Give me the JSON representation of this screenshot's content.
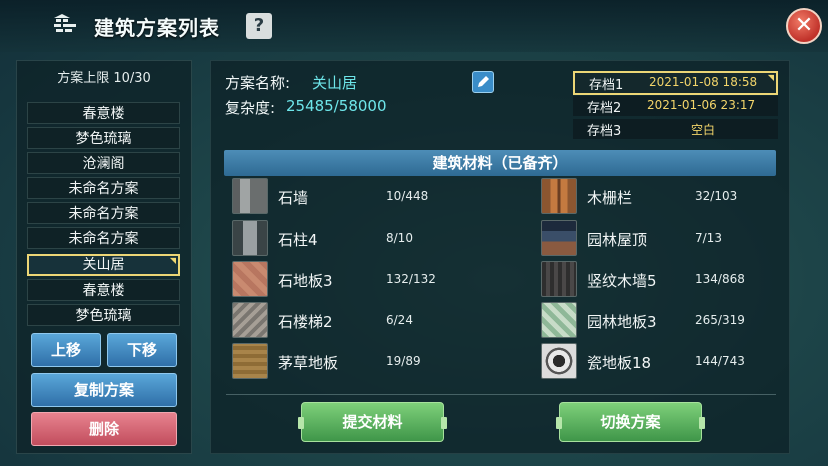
{
  "header": {
    "title": "建筑方案列表",
    "help": "?",
    "close": "✕"
  },
  "left": {
    "quota": "方案上限 10/30",
    "plans": [
      {
        "label": "春意楼"
      },
      {
        "label": "梦色琉璃"
      },
      {
        "label": "沧澜阁"
      },
      {
        "label": "未命名方案"
      },
      {
        "label": "未命名方案"
      },
      {
        "label": "未命名方案"
      },
      {
        "label": "关山居",
        "selected": true
      },
      {
        "label": "春意楼"
      },
      {
        "label": "梦色琉璃"
      }
    ],
    "move_up": "上移",
    "move_down": "下移",
    "copy": "复制方案",
    "delete": "删除"
  },
  "detail": {
    "name_label": "方案名称:",
    "name_value": "关山居",
    "complexity_label": "复杂度:",
    "complexity_value": "25485/58000",
    "saves": [
      {
        "name": "存档1",
        "date": "2021-01-08 18:58",
        "selected": true
      },
      {
        "name": "存档2",
        "date": "2021-01-06 23:17"
      },
      {
        "name": "存档3",
        "date": "空白"
      }
    ],
    "materials_header": "建筑材料（已备齐）",
    "materials": [
      {
        "name": "石墙",
        "count": "10/448"
      },
      {
        "name": "木栅栏",
        "count": "32/103"
      },
      {
        "name": "石柱4",
        "count": "8/10"
      },
      {
        "name": "园林屋顶",
        "count": "7/13"
      },
      {
        "name": "石地板3",
        "count": "132/132"
      },
      {
        "name": "竖纹木墙5",
        "count": "134/868"
      },
      {
        "name": "石楼梯2",
        "count": "6/24"
      },
      {
        "name": "园林地板3",
        "count": "265/319"
      },
      {
        "name": "茅草地板",
        "count": "19/89"
      },
      {
        "name": "瓷地板18",
        "count": "144/743"
      }
    ],
    "submit": "提交材料",
    "switch": "切换方案"
  }
}
